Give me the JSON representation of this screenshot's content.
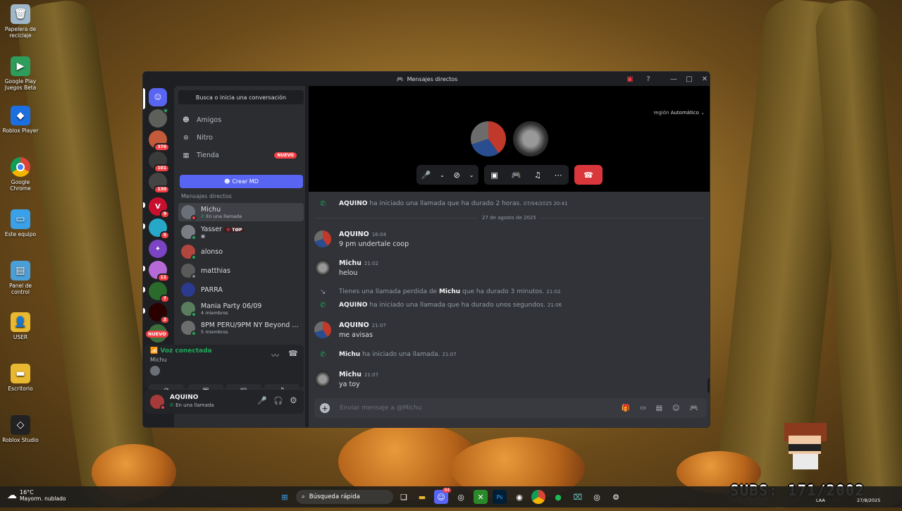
{
  "desktop": {
    "icons": [
      {
        "label": "Papelera de\nreciclaje",
        "icon": "recycle-bin-icon",
        "color": "#9fb7c9"
      },
      {
        "label": "Google Play\nJuegos Beta",
        "icon": "google-play-icon",
        "color": "#2e9c5a"
      },
      {
        "label": "Roblox Player",
        "icon": "roblox-icon",
        "color": "#1b6fe0"
      },
      {
        "label": "Google Chrome",
        "icon": "chrome-icon",
        "color": "#db4437"
      },
      {
        "label": "Este equipo",
        "icon": "computer-icon",
        "color": "#3aa0e8"
      },
      {
        "label": "Panel de control",
        "icon": "control-panel-icon",
        "color": "#4a9fd8"
      },
      {
        "label": "USER",
        "icon": "user-folder-icon",
        "color": "#e8b830"
      },
      {
        "label": "Escritorio",
        "icon": "desktop-folder-icon",
        "color": "#e8b830"
      },
      {
        "label": "Roblox Studio",
        "icon": "roblox-studio-icon",
        "color": "#222222"
      }
    ]
  },
  "window": {
    "title": "Mensajes directos"
  },
  "sidebar": {
    "search_placeholder": "Busca o inicia una conversación",
    "nav": [
      {
        "label": "Amigos",
        "icon": "friends-icon"
      },
      {
        "label": "Nitro",
        "icon": "nitro-icon"
      },
      {
        "label": "Tienda",
        "icon": "shop-icon",
        "badge": "NUEVO"
      }
    ],
    "create_dm": "Crear MD",
    "dm_header": "Mensajes directos",
    "dms": [
      {
        "name": "Michu",
        "sub": "En una llamada",
        "color": "#6b6f77"
      },
      {
        "name": "Yasser",
        "tag": "TØP",
        "sub": "",
        "color": "#7a7d83"
      },
      {
        "name": "alonso",
        "sub": "",
        "color": "#b2453d"
      },
      {
        "name": "matthias",
        "sub": "",
        "color": "#5a5a5a"
      },
      {
        "name": "PARRA",
        "sub": "",
        "color": "#2b3a8f"
      },
      {
        "name": "Mania Party 06/09",
        "sub": "4 miembros",
        "color": "#5a7d5e"
      },
      {
        "name": "8PM PERU/9PM NY Beyond T...",
        "sub": "5 miembros",
        "color": "#6d6d6d"
      }
    ],
    "guild_badges": [
      "370",
      "101",
      "130",
      "9",
      "5",
      "",
      "11",
      "7",
      "2",
      "NUEVO"
    ],
    "voice": {
      "status": "Voz conectada",
      "channel": "Michu"
    },
    "user": {
      "name": "AQUINO",
      "status": "En una llamada"
    }
  },
  "call": {
    "region_label": "región",
    "region_value": "Automático"
  },
  "messages": {
    "items": [
      {
        "type": "sys",
        "author": "AQUINO",
        "text": "ha iniciado una llamada que ha durado 2 horas.",
        "time": "07/04/2025 20:41"
      },
      {
        "type": "divider",
        "text": "27 de agosto de 2025"
      },
      {
        "type": "msg",
        "author": "AQUINO",
        "time": "16:04",
        "text": "9 pm undertale coop"
      },
      {
        "type": "msg",
        "author": "Michu",
        "time": "21:02",
        "text": "helou"
      },
      {
        "type": "missed",
        "pre": "Tienes una llamada perdida de",
        "author": "Michu",
        "text": "que ha durado 3 minutos.",
        "time": "21:02"
      },
      {
        "type": "sys",
        "author": "AQUINO",
        "text": "ha iniciado una llamada que ha durado unos segundos.",
        "time": "21:06"
      },
      {
        "type": "msg",
        "author": "AQUINO",
        "time": "21:07",
        "text": "me avisas"
      },
      {
        "type": "sys",
        "author": "Michu",
        "text": "ha iniciado una llamada.",
        "time": "21:07"
      },
      {
        "type": "msg",
        "author": "Michu",
        "time": "21:07",
        "text": "ya toy"
      }
    ],
    "input_placeholder": "Enviar mensaje a @Michu"
  },
  "taskbar": {
    "weather_temp": "16°C",
    "weather_desc": "Mayorm. nublado",
    "search_label": "Búsqueda rápida",
    "lang": "LAA",
    "date": "27/8/2025",
    "notif_badge": "94"
  },
  "overlay": {
    "subs_text": "SUBS: 171/2002"
  }
}
